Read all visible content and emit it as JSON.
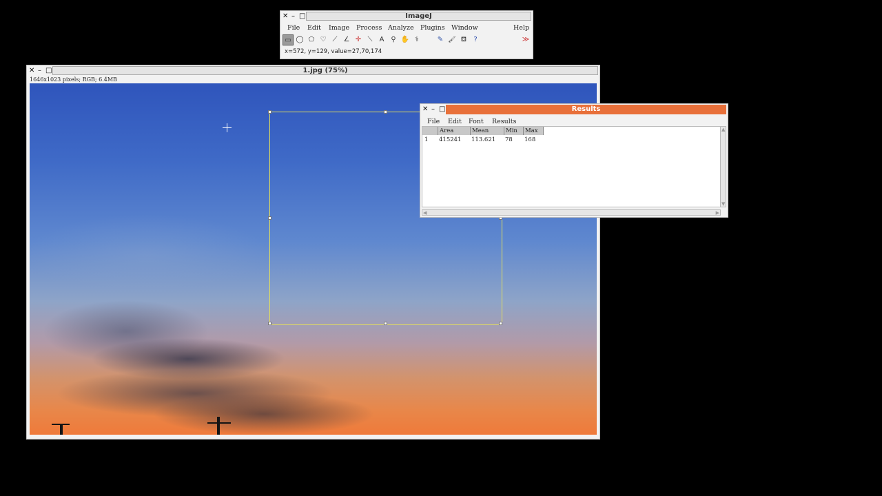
{
  "imagej": {
    "title": "ImageJ",
    "close": "✕",
    "minimize": "–",
    "maximize": "□",
    "menu": [
      "File",
      "Edit",
      "Image",
      "Process",
      "Analyze",
      "Plugins",
      "Window",
      "Help"
    ],
    "tools": [
      {
        "name": "rectangle-tool-icon",
        "glyph": "▭"
      },
      {
        "name": "oval-tool-icon",
        "glyph": "◯"
      },
      {
        "name": "polygon-tool-icon",
        "glyph": "⬠"
      },
      {
        "name": "freehand-tool-icon",
        "glyph": "♡"
      },
      {
        "name": "line-tool-icon",
        "glyph": "⟋"
      },
      {
        "name": "angle-tool-icon",
        "glyph": "∠"
      },
      {
        "name": "point-tool-icon",
        "glyph": "✛"
      },
      {
        "name": "wand-tool-icon",
        "glyph": "⟍"
      },
      {
        "name": "text-tool-icon",
        "glyph": "A"
      },
      {
        "name": "magnifier-tool-icon",
        "glyph": "⚲"
      },
      {
        "name": "hand-tool-icon",
        "glyph": "✋"
      },
      {
        "name": "dropper-tool-icon",
        "glyph": "⚕"
      },
      {
        "name": "pencil-tool-icon",
        "glyph": "✎"
      },
      {
        "name": "brush-tool-icon",
        "glyph": "🖌"
      },
      {
        "name": "flood-fill-tool-icon",
        "glyph": "⛾"
      },
      {
        "name": "help-tool-icon",
        "glyph": "?"
      },
      {
        "name": "more-tools-icon",
        "glyph": "≫"
      }
    ],
    "status": "x=572, y=129, value=27,70,174"
  },
  "image_window": {
    "title": "1.jpg (75%)",
    "info": "1646x1023 pixels; RGB; 6.4MB"
  },
  "results": {
    "title": "Results",
    "menu": [
      "File",
      "Edit",
      "Font",
      "Results"
    ],
    "columns": [
      "",
      "Area",
      "Mean",
      "Min",
      "Max"
    ],
    "rows": [
      [
        "1",
        "415241",
        "113.621",
        "78",
        "168"
      ]
    ]
  },
  "colors": {
    "results_title_bg": "#e8703a",
    "roi_outline": "#e5e05a",
    "desktop_bg": "#000000"
  }
}
